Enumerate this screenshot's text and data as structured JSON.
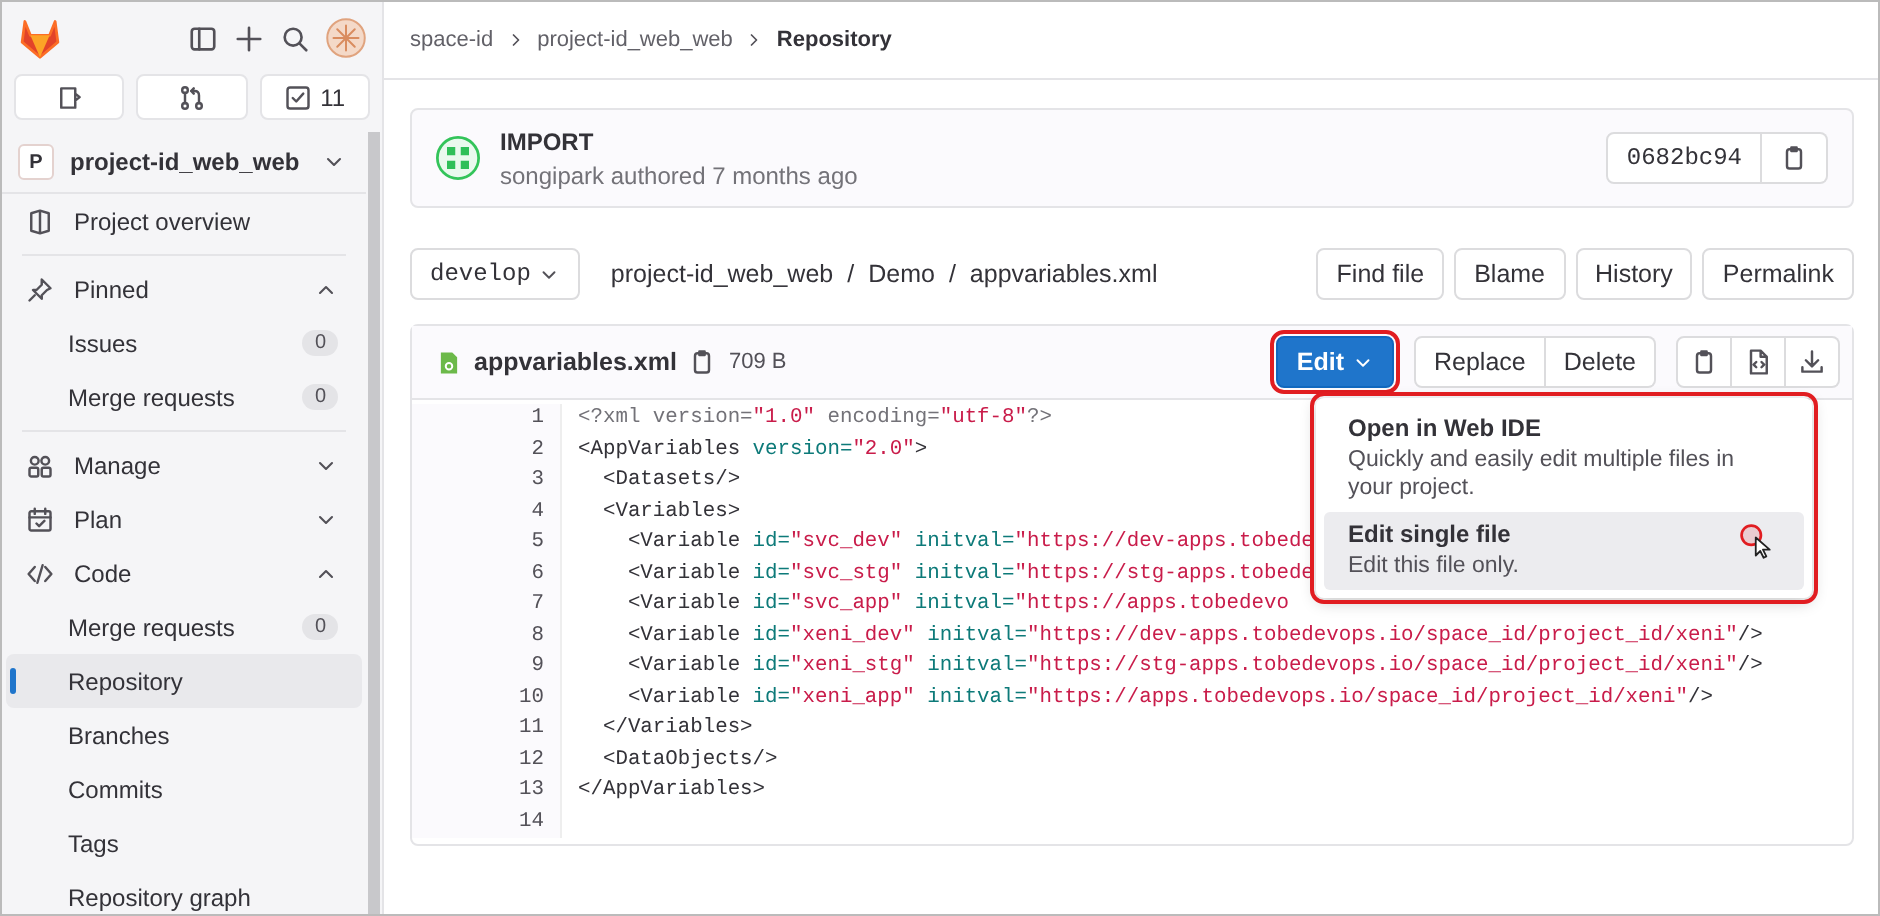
{
  "top_bar": {
    "todo_count": "11"
  },
  "sidebar": {
    "project": {
      "initial": "P",
      "name": "project-id_web_web"
    },
    "items": [
      {
        "kind": "link",
        "label": "Project overview",
        "selected": false
      },
      {
        "kind": "section",
        "label": "Pinned",
        "expanded": true,
        "children": [
          {
            "label": "Issues",
            "count": "0",
            "selected": false
          },
          {
            "label": "Merge requests",
            "count": "0",
            "selected": false
          }
        ]
      },
      {
        "kind": "section",
        "label": "Manage",
        "expanded": false
      },
      {
        "kind": "section",
        "label": "Plan",
        "expanded": false
      },
      {
        "kind": "section",
        "label": "Code",
        "expanded": true,
        "children": [
          {
            "label": "Merge requests",
            "count": "0",
            "selected": false
          },
          {
            "label": "Repository",
            "selected": true
          },
          {
            "label": "Branches",
            "selected": false
          },
          {
            "label": "Commits",
            "selected": false
          },
          {
            "label": "Tags",
            "selected": false
          },
          {
            "label": "Repository graph",
            "selected": false
          }
        ]
      }
    ]
  },
  "breadcrumb": [
    "space-id",
    "project-id_web_web",
    "Repository"
  ],
  "commit": {
    "title": "IMPORT",
    "author_line": "songipark authored 7 months ago",
    "sha": "0682bc94"
  },
  "toolbar": {
    "branch": "develop",
    "path": [
      "project-id_web_web",
      "Demo",
      "appvariables.xml"
    ],
    "path_separator": "/",
    "buttons": [
      "Find file",
      "Blame",
      "History",
      "Permalink"
    ]
  },
  "file": {
    "name": "appvariables.xml",
    "size": "709 B",
    "edit_button": {
      "label": "Edit",
      "highlighted": true
    },
    "buttons": [
      "Replace",
      "Delete"
    ]
  },
  "edit_menu": {
    "highlighted": true,
    "items": [
      {
        "title": "Open in Web IDE",
        "description": "Quickly and easily edit multiple files in your project.",
        "selected": false,
        "pointer": false
      },
      {
        "title": "Edit single file",
        "description": "Edit this file only.",
        "selected": true,
        "pointer": true
      }
    ]
  },
  "code": [
    {
      "number": "1",
      "tokens": [
        {
          "kind": "plain",
          "text": "<?xml version="
        },
        {
          "kind": "string",
          "text": "\"1.0\""
        },
        {
          "kind": "plain",
          "text": " encoding="
        },
        {
          "kind": "string",
          "text": "\"utf-8\""
        },
        {
          "kind": "plain",
          "text": "?>"
        }
      ]
    },
    {
      "number": "2",
      "tokens": [
        {
          "kind": "tag",
          "text": "<AppVariables "
        },
        {
          "kind": "attr",
          "text": "version="
        },
        {
          "kind": "string",
          "text": "\"2.0\""
        },
        {
          "kind": "tag",
          "text": ">"
        }
      ]
    },
    {
      "number": "3",
      "tokens": [
        {
          "kind": "tag",
          "text": "  <Datasets/>"
        }
      ]
    },
    {
      "number": "4",
      "tokens": [
        {
          "kind": "tag",
          "text": "  <Variables>"
        }
      ]
    },
    {
      "number": "5",
      "tokens": [
        {
          "kind": "tag",
          "text": "    <Variable "
        },
        {
          "kind": "attr",
          "text": "id="
        },
        {
          "kind": "string",
          "text": "\"svc_dev\""
        },
        {
          "kind": "attr",
          "text": " initval="
        },
        {
          "kind": "string",
          "text": "\"https://dev-apps.tobede"
        }
      ]
    },
    {
      "number": "6",
      "tokens": [
        {
          "kind": "tag",
          "text": "    <Variable "
        },
        {
          "kind": "attr",
          "text": "id="
        },
        {
          "kind": "string",
          "text": "\"svc_stg\""
        },
        {
          "kind": "attr",
          "text": " initval="
        },
        {
          "kind": "string",
          "text": "\"https://stg-apps.tobede"
        }
      ]
    },
    {
      "number": "7",
      "tokens": [
        {
          "kind": "tag",
          "text": "    <Variable "
        },
        {
          "kind": "attr",
          "text": "id="
        },
        {
          "kind": "string",
          "text": "\"svc_app\""
        },
        {
          "kind": "attr",
          "text": " initval="
        },
        {
          "kind": "string",
          "text": "\"https://apps.tobedevo"
        }
      ]
    },
    {
      "number": "8",
      "tokens": [
        {
          "kind": "tag",
          "text": "    <Variable "
        },
        {
          "kind": "attr",
          "text": "id="
        },
        {
          "kind": "string",
          "text": "\"xeni_dev\""
        },
        {
          "kind": "attr",
          "text": " initval="
        },
        {
          "kind": "string",
          "text": "\"https://dev-apps.tobedevops.io/space_id/project_id/xeni\""
        },
        {
          "kind": "tag",
          "text": "/>"
        }
      ]
    },
    {
      "number": "9",
      "tokens": [
        {
          "kind": "tag",
          "text": "    <Variable "
        },
        {
          "kind": "attr",
          "text": "id="
        },
        {
          "kind": "string",
          "text": "\"xeni_stg\""
        },
        {
          "kind": "attr",
          "text": " initval="
        },
        {
          "kind": "string",
          "text": "\"https://stg-apps.tobedevops.io/space_id/project_id/xeni\""
        },
        {
          "kind": "tag",
          "text": "/>"
        }
      ]
    },
    {
      "number": "10",
      "tokens": [
        {
          "kind": "tag",
          "text": "    <Variable "
        },
        {
          "kind": "attr",
          "text": "id="
        },
        {
          "kind": "string",
          "text": "\"xeni_app\""
        },
        {
          "kind": "attr",
          "text": " initval="
        },
        {
          "kind": "string",
          "text": "\"https://apps.tobedevops.io/space_id/project_id/xeni\""
        },
        {
          "kind": "tag",
          "text": "/>"
        }
      ]
    },
    {
      "number": "11",
      "tokens": [
        {
          "kind": "tag",
          "text": "  </Variables>"
        }
      ]
    },
    {
      "number": "12",
      "tokens": [
        {
          "kind": "tag",
          "text": "  <DataObjects/>"
        }
      ]
    },
    {
      "number": "13",
      "tokens": [
        {
          "kind": "tag",
          "text": "</AppVariables>"
        }
      ]
    },
    {
      "number": "14"
    }
  ]
}
